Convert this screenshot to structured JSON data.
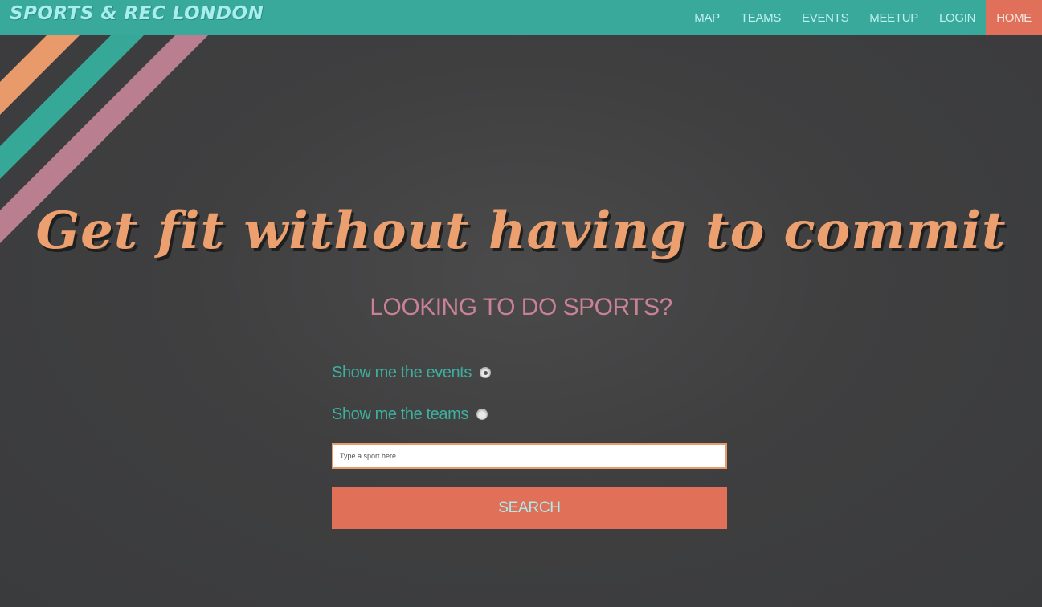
{
  "header": {
    "brand": "SPORTS & REC LONDON",
    "nav": [
      {
        "label": "MAP",
        "active": false
      },
      {
        "label": "TEAMS",
        "active": false
      },
      {
        "label": "EVENTS",
        "active": false
      },
      {
        "label": "MEETUP",
        "active": false
      },
      {
        "label": "LOGIN",
        "active": false
      },
      {
        "label": "HOME",
        "active": true
      }
    ]
  },
  "hero": {
    "title": "Get fit without having to commit",
    "subtitle": "LOOKING TO DO SPORTS?"
  },
  "form": {
    "options": [
      {
        "label": "Show me the events",
        "checked": true
      },
      {
        "label": "Show me the teams",
        "checked": false
      }
    ],
    "search_placeholder": "Type a sport here",
    "search_value": "",
    "submit_label": "SEARCH"
  },
  "colors": {
    "nav_bg": "#38a99a",
    "accent": "#e07058",
    "title": "#eca06f",
    "subtitle": "#c98196",
    "stripe_orange": "#e89a6a",
    "stripe_teal": "#35a898",
    "stripe_pink": "#b97f91"
  }
}
